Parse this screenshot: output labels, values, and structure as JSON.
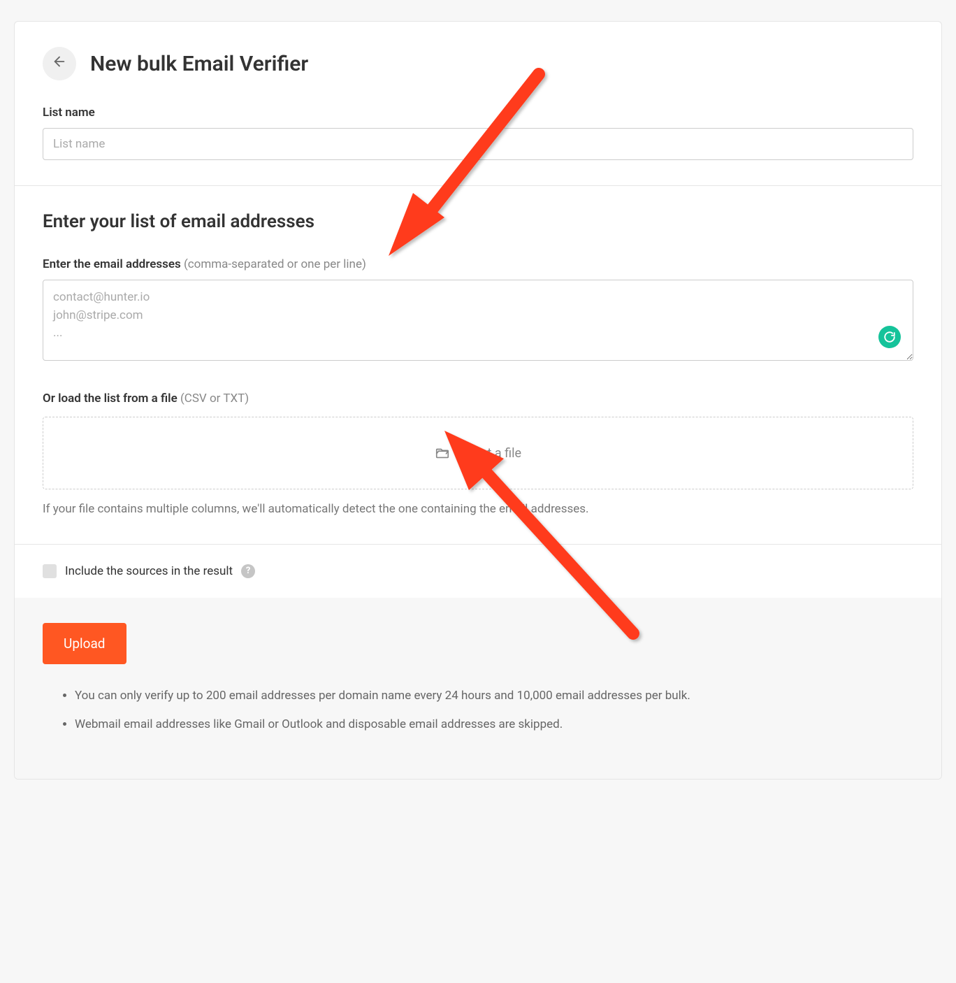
{
  "header": {
    "title": "New bulk Email Verifier"
  },
  "listName": {
    "label": "List name",
    "placeholder": "List name"
  },
  "emailSection": {
    "heading": "Enter your list of email addresses",
    "enterLabel": "Enter the email addresses",
    "enterHint": "(comma-separated or one per line)",
    "placeholder": "contact@hunter.io\njohn@stripe.com\n...",
    "fileLabel": "Or load the list from a file",
    "fileHint": "(CSV or TXT)",
    "selectFile": "Select a file",
    "fileHelp": "If your file contains multiple columns, we'll automatically detect the one containing the email addresses."
  },
  "options": {
    "includeSources": "Include the sources in the result"
  },
  "footer": {
    "uploadLabel": "Upload",
    "notes": [
      "You can only verify up to 200 email addresses per domain name every 24 hours and 10,000 email addresses per bulk.",
      "Webmail email addresses like Gmail or Outlook and disposable email addresses are skipped."
    ]
  },
  "annotations": {
    "arrowColor": "#ff3b1f"
  }
}
